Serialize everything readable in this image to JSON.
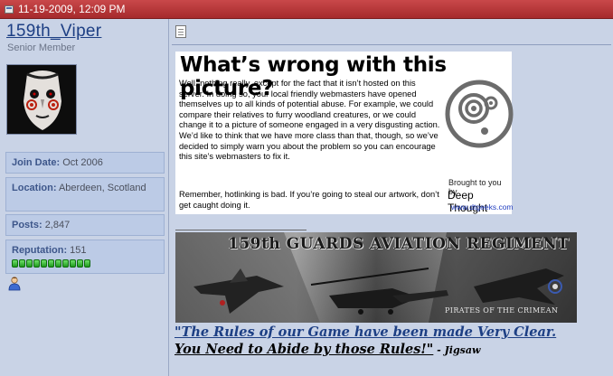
{
  "post": {
    "date": "11-19-2009, 12:09 PM"
  },
  "user": {
    "name": "159th_Viper",
    "title": "Senior Member",
    "join_label": "Join Date:",
    "join_value": "Oct 2006",
    "location_label": "Location:",
    "location_value": "Aberdeen, Scotland",
    "posts_label": "Posts:",
    "posts_value": "2,847",
    "reputation_label": "Reputation:",
    "reputation_value": "151",
    "reputation_pips": 11,
    "icons": [
      "avatar",
      "user-online-icon"
    ]
  },
  "hotlink_notice": {
    "title": "What’s wrong with this picture?",
    "body": "Well, nothing really, except for the fact that it isn’t hosted on this server.  In doing so, your local friendly webmasters have opened themselves up to all kinds of potential abuse.  For example, we could compare their relatives to furry woodland creatures, or we could change it to a picture of someone engaged in a very disgusting action.  We’d like to think that we have more class than that, though, so we’ve decided to simply warn you about the problem so you can encourage this site’s webmasters to fix it.",
    "body2": "Remember, hotlinking is bad.  If you’re going to steal our artwork, don’t get caught doing it.",
    "brought_by": "Brought to you by",
    "brand": "Deep Thought",
    "url": "www.dtgeeks.com"
  },
  "signature": {
    "banner_title": "159th GUARDS AVIATION REGIMENT",
    "banner_tagline": "PIRATES OF THE CRIMEAN",
    "quote_line1": "\"The Rules of our Game have been made Very Clear.",
    "quote_line2": "You Need to Abide by those Rules!\"",
    "quote_attr": " - Jigsaw"
  },
  "colors": {
    "header_red": "#b53537",
    "sidebar_bg": "#c9d3e6",
    "link_blue": "#1d3f84",
    "rep_green": "#3cc43a"
  }
}
